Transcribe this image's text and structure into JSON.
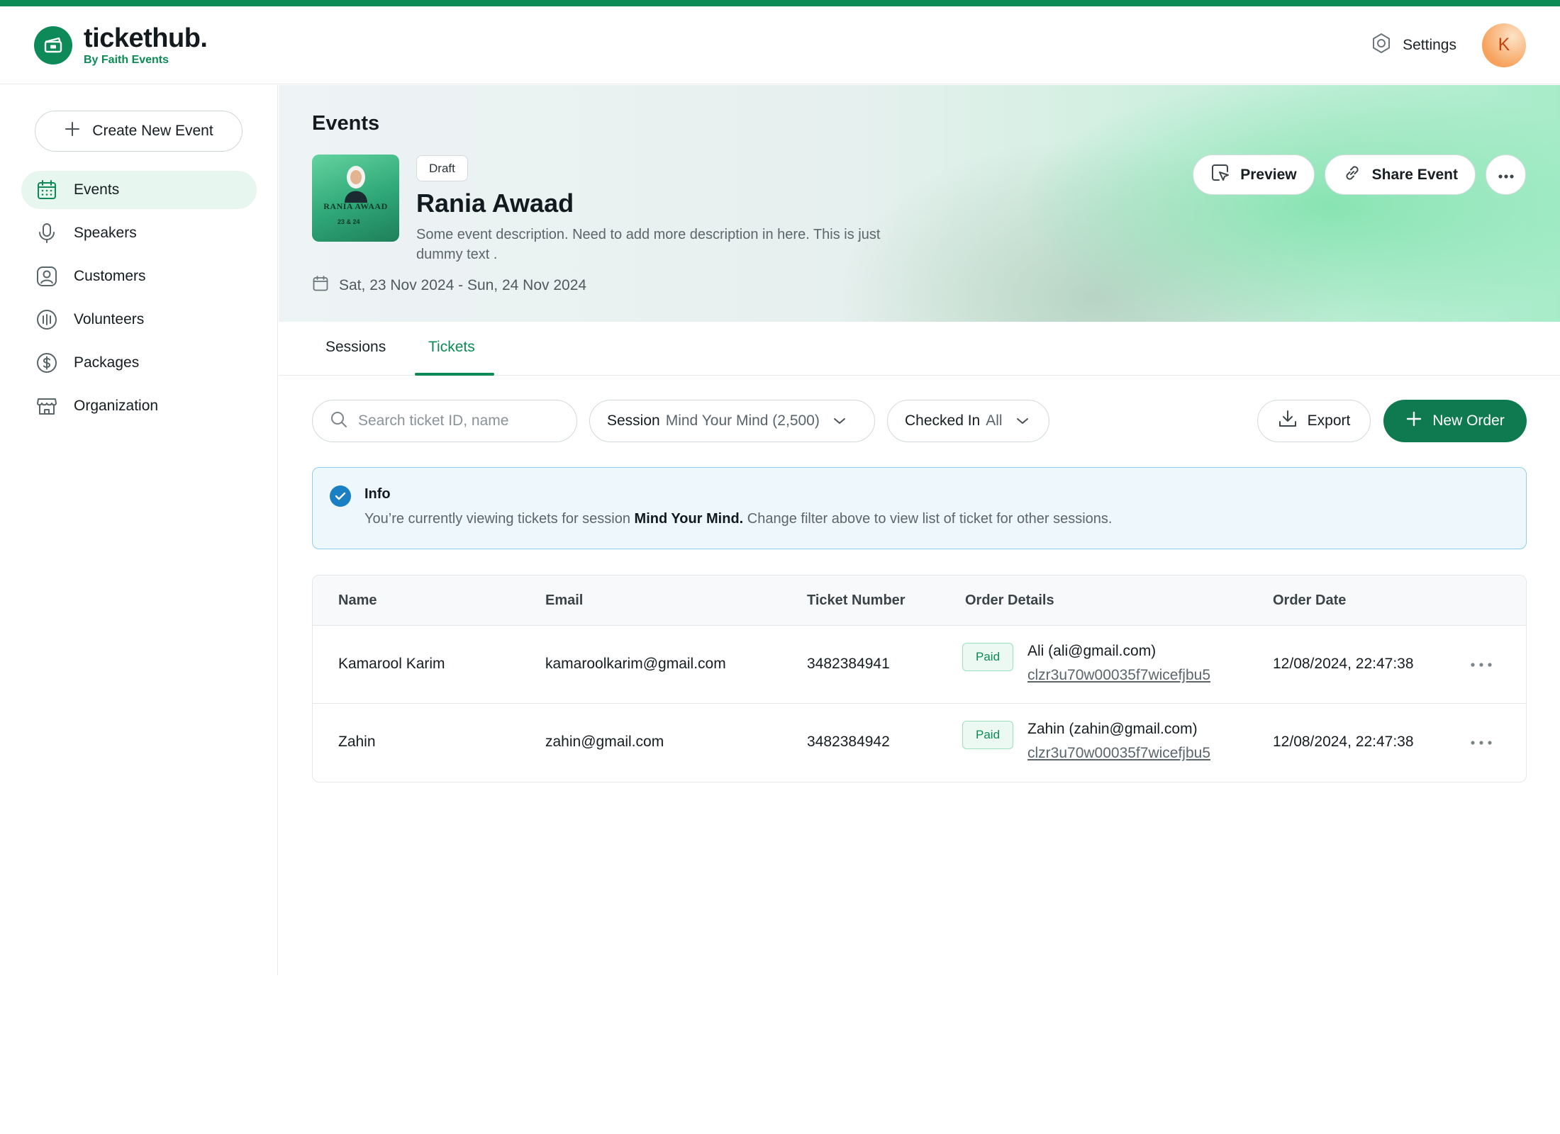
{
  "brand": {
    "name": "tickethub.",
    "sub": "By Faith Events"
  },
  "header": {
    "settings_label": "Settings",
    "avatar_initial": "K"
  },
  "sidebar": {
    "create_label": "Create New Event",
    "items": [
      {
        "label": "Events",
        "icon": "calendar-icon",
        "active": true
      },
      {
        "label": "Speakers",
        "icon": "microphone-icon"
      },
      {
        "label": "Customers",
        "icon": "user-circle-icon"
      },
      {
        "label": "Volunteers",
        "icon": "volunteer-icon"
      },
      {
        "label": "Packages",
        "icon": "dollar-icon"
      },
      {
        "label": "Organization",
        "icon": "store-icon"
      }
    ]
  },
  "event": {
    "page_title": "Events",
    "status": "Draft",
    "name": "Rania Awaad",
    "description": "Some event description. Need to add more description in here. This is just dummy text .",
    "dates": "Sat, 23 Nov 2024 - Sun, 24 Nov 2024",
    "poster_title": "RANIA AWAAD",
    "poster_dates": "23 & 24"
  },
  "actions": {
    "preview": "Preview",
    "share": "Share Event"
  },
  "tabs": [
    {
      "label": "Sessions",
      "active": false
    },
    {
      "label": "Tickets",
      "active": true
    }
  ],
  "toolbar": {
    "search_placeholder": "Search ticket ID, name",
    "session_label": "Session",
    "session_value": "Mind Your Mind (2,500)",
    "checked_label": "Checked In",
    "checked_value": "All",
    "export_label": "Export",
    "new_order_label": "New Order"
  },
  "info": {
    "title": "Info",
    "msg_prefix": "You’re currently viewing tickets for session",
    "msg_bold": "Mind Your Mind.",
    "msg_suffix": "Change filter above to view list of ticket for other sessions."
  },
  "table": {
    "headers": [
      "Name",
      "Email",
      "Ticket Number",
      "Order Details",
      "Order Date"
    ],
    "rows": [
      {
        "name": "Kamarool Karim",
        "email": "kamaroolkarim@gmail.com",
        "ticket": "3482384941",
        "status": "Paid",
        "order_by": "Ali (ali@gmail.com)",
        "order_id": "clzr3u70w00035f7wicefjbu5",
        "date": "12/08/2024, 22:47:38"
      },
      {
        "name": "Zahin",
        "email": "zahin@gmail.com",
        "ticket": "3482384942",
        "status": "Paid",
        "order_by": "Zahin (zahin@gmail.com)",
        "order_id": "clzr3u70w00035f7wicefjbu5",
        "date": "12/08/2024, 22:47:38"
      }
    ]
  },
  "colors": {
    "brand": "#0b8a55",
    "primary_button": "#0f7a4f",
    "info_border": "#8fcde8",
    "info_icon": "#1b7fc4"
  }
}
